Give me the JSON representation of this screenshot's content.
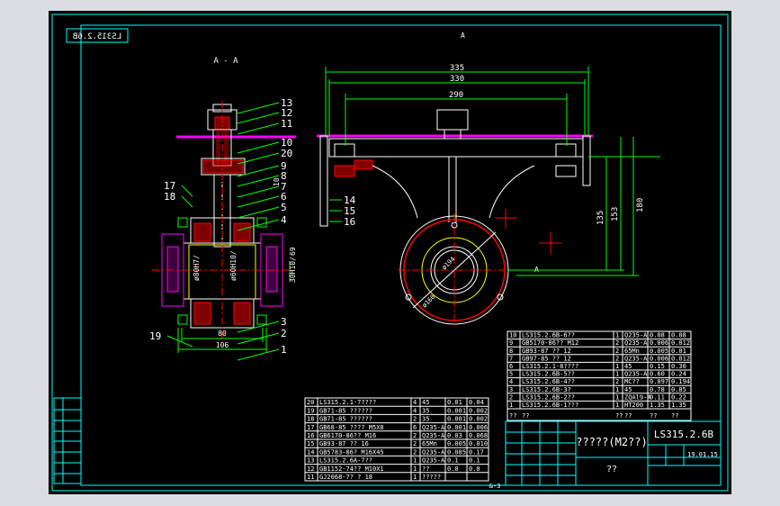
{
  "drawing_code": "LS315.2.6B",
  "drawing_code_mirrored": "LS315.2.6B",
  "section_label": "A - A",
  "section_marker": "A",
  "title_block": {
    "part_name": "?????(M2??)",
    "code": "LS315.2.6B",
    "scale_note": "19.01.15",
    "bottom_cell": "??"
  },
  "colors": {
    "background": "#000000",
    "frame": "#00ffff",
    "outline": "#ffffff",
    "hatch": "#ff0000",
    "flange": "#ff00ff",
    "dim": "#00ff00",
    "yellow": "#ffff00"
  },
  "dims_top": [
    "335",
    "330",
    "290"
  ],
  "dims_right": [
    "135",
    "153",
    "180"
  ],
  "dims_section": [
    "80",
    "106",
    "ø80H7/",
    "ø60H10/",
    "30H10/",
    "10",
    "69"
  ],
  "dims_circle": [
    "ø194",
    "ø160"
  ],
  "part_numbers_left": [
    "13",
    "12",
    "11",
    "10",
    "20",
    "9",
    "8",
    "7",
    "6",
    "17",
    "18",
    "5",
    "4",
    "19",
    "3",
    "2",
    "1"
  ],
  "part_numbers_right": [
    "14",
    "15",
    "16"
  ],
  "bom_upper": [
    {
      "no": "10",
      "code": "LS315.2.6B-6??",
      "qty": "1",
      "mat": "Q235-A",
      "mass": "0.08",
      "tot": "0.08"
    },
    {
      "no": "9",
      "code": "GB5170-86?? M12",
      "qty": "2",
      "mat": "Q235-A",
      "mass": "0.006",
      "tot": "0.012"
    },
    {
      "no": "8",
      "code": "GB93-87  ?? 12",
      "qty": "2",
      "mat": "65Mn",
      "mass": "0.005",
      "tot": "0.01"
    },
    {
      "no": "7",
      "code": "GB97-85  ?? 12",
      "qty": "2",
      "mat": "Q235-A",
      "mass": "0.006",
      "tot": "0.012"
    },
    {
      "no": "6",
      "code": "LS315.2.1-8????",
      "qty": "1",
      "mat": "45",
      "mass": "0.15",
      "tot": "0.30"
    },
    {
      "no": "5",
      "code": "LS315.2.6B-5??",
      "qty": "1",
      "mat": "Q235-A",
      "mass": "0.60",
      "tot": "0.24"
    },
    {
      "no": "4",
      "code": "LS315.2.6B-4??",
      "qty": "2",
      "mat": "MC??",
      "mass": "0.097",
      "tot": "0.194"
    },
    {
      "no": "3",
      "code": "LS315.2.6B-3?",
      "qty": "1",
      "mat": "45",
      "mass": "0.78",
      "tot": "0.85"
    },
    {
      "no": "2",
      "code": "LS315.2.6B-2??",
      "qty": "1",
      "mat": "ZQAl9-4",
      "mass": "0.11",
      "tot": "0.22"
    },
    {
      "no": "1",
      "code": "LS315.2.6B-1???",
      "qty": "1",
      "mat": "HT200",
      "mass": "1.35",
      "tot": "1.35"
    }
  ],
  "bom_upper_header": [
    "??",
    "??",
    "??",
    "??",
    "??",
    "??"
  ],
  "bom_lower": [
    {
      "no": "20",
      "code": "LS315.2.1-7????",
      "qty": "4",
      "mat": "45",
      "mass": "0.01",
      "tot": "0.04"
    },
    {
      "no": "19",
      "code": "GB71-85  ??????",
      "qty": "4",
      "mat": "35",
      "mass": "0.001",
      "tot": "0.002"
    },
    {
      "no": "18",
      "code": "GB71-85  ??????",
      "qty": "2",
      "mat": "35",
      "mass": "0.001",
      "tot": "0.002"
    },
    {
      "no": "17",
      "code": "GB68-85 ???? M5X8",
      "qty": "6",
      "mat": "Q235-A",
      "mass": "0.001",
      "tot": "0.006"
    },
    {
      "no": "16",
      "code": "GB6170-86?? M16",
      "qty": "2",
      "mat": "Q235-A",
      "mass": "0.03",
      "tot": "0.068"
    },
    {
      "no": "15",
      "code": "GB93-87  ?? 16",
      "qty": "2",
      "mat": "65Mn",
      "mass": "0.005",
      "tot": "0.010"
    },
    {
      "no": "14",
      "code": "GB5783-86? M16X45",
      "qty": "2",
      "mat": "Q235-A",
      "mass": "0.085",
      "tot": "0.17"
    },
    {
      "no": "13",
      "code": "LS315.2.6A-7??",
      "qty": "1",
      "mat": "Q235-A",
      "mass": "0.1",
      "tot": "0.1"
    },
    {
      "no": "12",
      "code": "GB1152-74?? M10X1",
      "qty": "1",
      "mat": "??",
      "mass": "0.0",
      "tot": "0.0"
    },
    {
      "no": "11",
      "code": "GJ2068-7?   ? 18",
      "qty": "1",
      "mat": "?????",
      "mass": "",
      "tot": ""
    }
  ],
  "page_label": "&-3"
}
